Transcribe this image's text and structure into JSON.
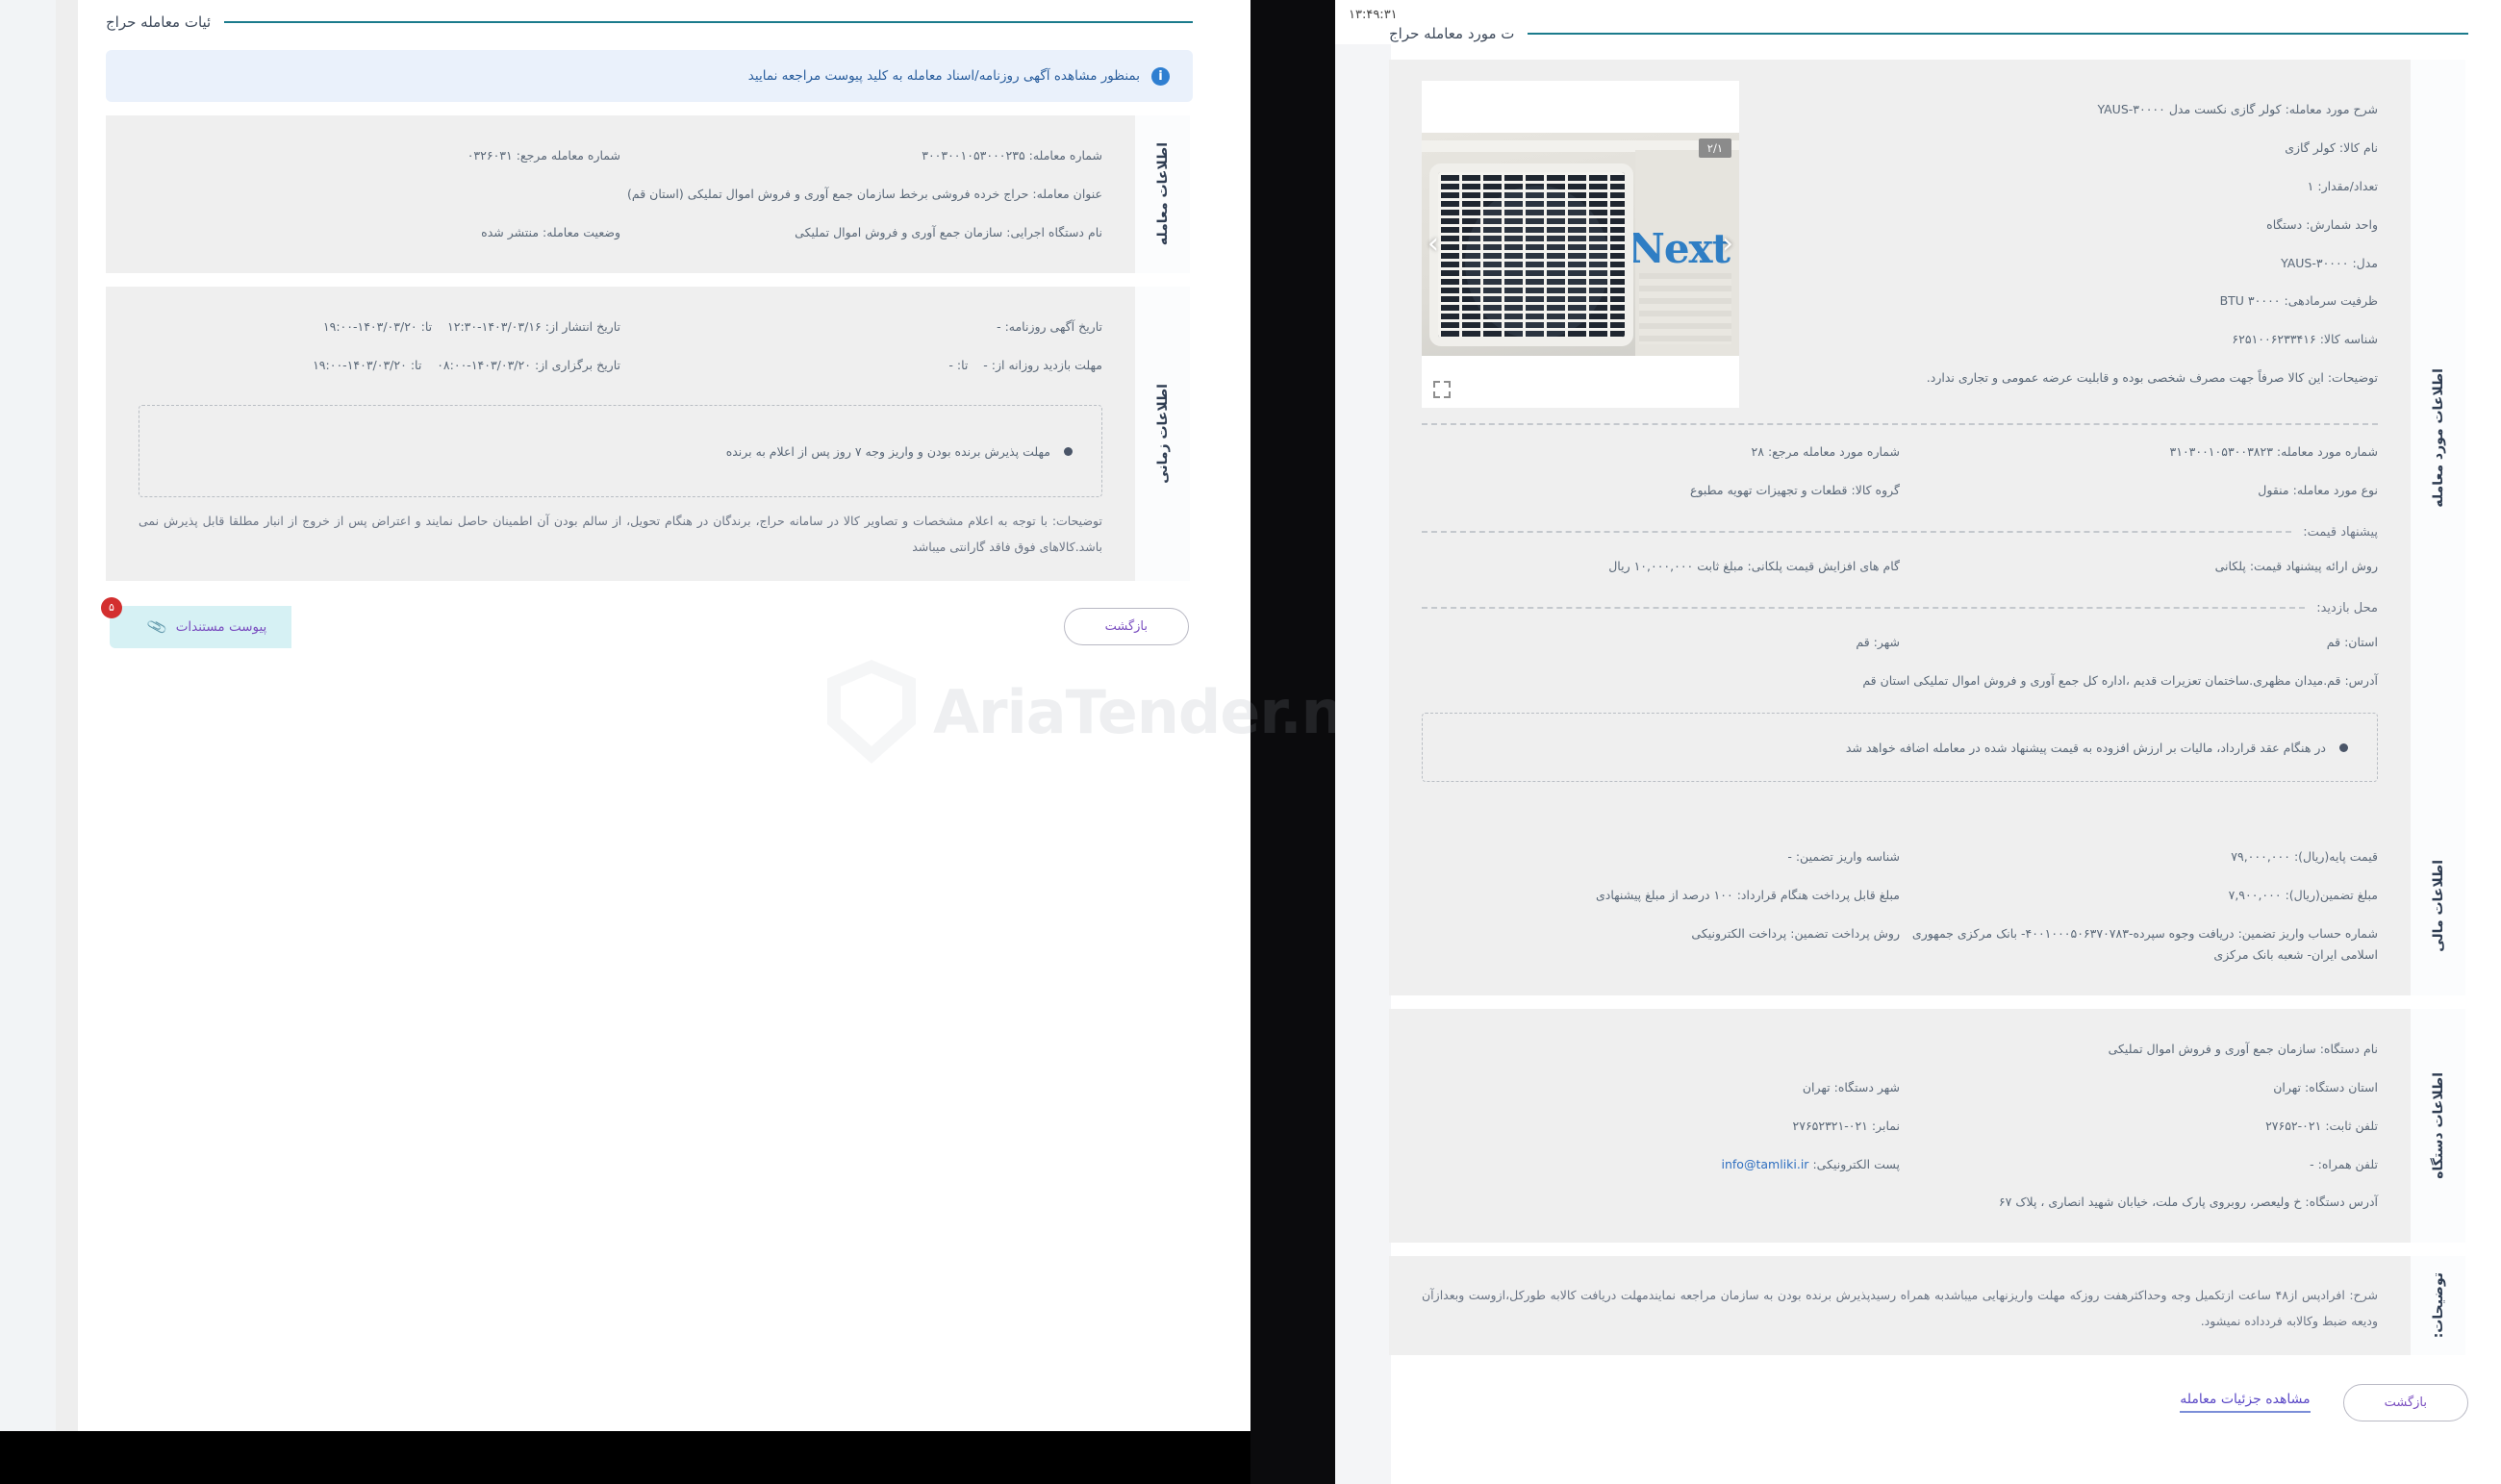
{
  "left_window": {
    "section_title": "ئیات معامله حراج",
    "info_banner": {
      "text": "بمنظور مشاهده آگهی روزنامه/اسناد معامله به کلید پیوست مراجعه نمایید",
      "icon": "info-icon"
    },
    "deal_info": {
      "tab_label": "اطلاعات معامله",
      "transaction_number_label": "شماره معامله:",
      "transaction_number_value": "۳۰۰۳۰۰۱۰۵۳۰۰۰۲۳۵",
      "reference_number_label": "شماره معامله مرجع:",
      "reference_number_value": "۰۳۲۶۰۳۱",
      "title_label": "عنوان معامله:",
      "title_value": "حراج خرده فروشی برخط سازمان جمع آوری و فروش اموال تملیکی (استان قم)",
      "agency_label": "نام دستگاه اجرایی:",
      "agency_value": "سازمان جمع آوری و فروش اموال تملیکی",
      "status_label": "وضعیت معامله:",
      "status_value": "منتشر شده"
    },
    "time_info": {
      "tab_label": "اطلاعات زمانی",
      "newspaper_ad_date_label": "تاریخ آگهی روزنامه:",
      "newspaper_ad_date_value": "-",
      "publish_label": "تاریخ انتشار از:",
      "publish_from": "۱۴۰۳/۰۳/۱۶-۱۲:۳۰",
      "publish_to_label": "تا:",
      "publish_to": "۱۴۰۳/۰۳/۲۰-۱۹:۰۰",
      "visit_label": "مهلت بازدید روزانه از:",
      "visit_from": "-",
      "visit_to_label": "تا:",
      "visit_to": "-",
      "hold_label": "تاریخ برگزاری از:",
      "hold_from": "۱۴۰۳/۰۳/۲۰-۰۸:۰۰",
      "hold_to_label": "تا:",
      "hold_to": "۱۴۰۳/۰۳/۲۰-۱۹:۰۰",
      "deadline_note": "مهلت پذیرش برنده بودن و واریز وجه ۷ روز پس از اعلام به برنده",
      "description": "توضیحات: با توجه به اعلام مشخصات و تصاویر کالا در سامانه حراج، برندگان در هنگام تحویل، از سالم بودن آن اطمینان حاصل نمایند و اعتراض پس از خروج از انبار مطلقا قابل پذیرش نمی باشد.کالاهای فوق فاقد گارانتی میباشد"
    },
    "buttons": {
      "back": "بازگشت",
      "attachments": "پیوست مستندات",
      "attachments_badge": "۵"
    }
  },
  "right_window": {
    "clock": "۱۳:۴۹:۳۱",
    "section_title": "ت مورد معامله حراج",
    "item_info": {
      "tab_label": "اطلاعات مورد معامله",
      "gallery_counter": "۲/۱",
      "specs": [
        {
          "label": "شرح مورد معامله:",
          "value": "کولر گازی نکست مدل YAUS-۳۰۰۰۰"
        },
        {
          "label": "نام کالا:",
          "value": "کولر گازی"
        },
        {
          "label": "تعداد/مقدار:",
          "value": "۱"
        },
        {
          "label": "واحد شمارش:",
          "value": "دستگاه"
        },
        {
          "label": "مدل:",
          "value": "YAUS-۳۰۰۰۰"
        },
        {
          "label": "ظرفیت سرمادهی:",
          "value": "۳۰۰۰۰ BTU"
        },
        {
          "label": "شناسه کالا:",
          "value": "۶۲۵۱۰۰۶۲۳۳۴۱۶"
        },
        {
          "label": "توضیحات:",
          "value": "این کالا صرفاً جهت مصرف شخصی بوده و قابلیت عرضه عمومی و تجاری ندارد."
        }
      ],
      "item_number_label": "شماره مورد معامله:",
      "item_number_value": "۳۱۰۳۰۰۱۰۵۳۰۰۳۸۲۳",
      "item_ref_label": "شماره مورد معامله مرجع:",
      "item_ref_value": "۲۸",
      "item_type_label": "نوع مورد معامله:",
      "item_type_value": "منقول",
      "item_group_label": "گروه کالا:",
      "item_group_value": "قطعات و تجهیزات تهویه مطبوع",
      "price_offer_header": "پیشنهاد قیمت:",
      "offer_method_label": "روش ارائه پیشنهاد قیمت:",
      "offer_method_value": "پلکانی",
      "step_label": "گام های افزایش قیمت پلکانی:",
      "step_value": "مبلغ ثابت ۱۰,۰۰۰,۰۰۰ ریال",
      "visit_place_header": "محل بازدید:",
      "province_label": "استان:",
      "province_value": "قم",
      "city_label": "شهر:",
      "city_value": "قم",
      "address_label": "آدرس:",
      "address_value": "قم.میدان مظهری.ساختمان تعزیرات قدیم ،اداره کل جمع آوری و فروش اموال تملیکی استان قم"
    },
    "financial_info": {
      "tab_label": "اطلاعات مالی",
      "vat_note": "در هنگام عقد قرارداد، مالیات بر ارزش افزوده به قیمت پیشنهاد شده در معامله اضافه خواهد شد",
      "base_price_label": "قیمت پایه(ریال):",
      "base_price_value": "۷۹,۰۰۰,۰۰۰",
      "guarantee_id_label": "شناسه واریز تضمین:",
      "guarantee_id_value": "-",
      "guarantee_amount_label": "مبلغ تضمین(ریال):",
      "guarantee_amount_value": "۷,۹۰۰,۰۰۰",
      "payable_label": "مبلغ قابل پرداخت هنگام قرارداد:",
      "payable_value": "۱۰۰ درصد از مبلغ پیشنهادی",
      "account_label": "شماره حساب واریز تضمین:",
      "account_value": "دریافت وجوه سپرده-۴۰۰۱۰۰۰۵۰۶۳۷۰۷۸۳- بانک مرکزی جمهوری اسلامی ایران- شعبه بانک مرکزی",
      "pay_method_label": "روش پرداخت تضمین:",
      "pay_method_value": "پرداخت الکترونیکی"
    },
    "agency_info": {
      "tab_label": "اطلاعات دستگاه",
      "name_label": "نام دستگاه:",
      "name_value": "سازمان جمع آوری و فروش اموال تملیکی",
      "province_label": "استان دستگاه:",
      "province_value": "تهران",
      "city_label": "شهر دستگاه:",
      "city_value": "تهران",
      "tel_label": "تلفن ثابت:",
      "tel_value": "۰۲۱-۲۷۶۵۲",
      "fax_label": "نمابر:",
      "fax_value": "۰۲۱-۲۷۶۵۲۳۲۱",
      "mobile_label": "تلفن همراه:",
      "mobile_value": "-",
      "email_label": "پست الکترونیکی:",
      "email_value": "info@tamliki.ir",
      "address_label": "آدرس دستگاه:",
      "address_value": "خ ولیعصر، روبروی پارک ملت، خیابان شهید انصاری ، پلاک ۶۷"
    },
    "remarks": {
      "tab_label": "توضیحات:",
      "text": "شرح: افرادپس از۴۸ ساعت ازتکمیل وجه وحداکثرهفت روزکه مهلت واریزنهایی میباشدبه همراه رسیدپذیرش برنده بودن به سازمان مراجعه نمایندمهلت دریافت کالابه طورکل،ازوست وبعدازآن ودیعه ضبط وکالابه فردداده نمیشود."
    },
    "footer": {
      "details_link": "مشاهده جزئیات معامله",
      "back": "بازگشت"
    }
  },
  "watermark": {
    "text": "AriaTender.neT",
    "icon": "shield-icon"
  },
  "colors": {
    "accent_teal": "#1b7b8c",
    "info_blue": "#2f7fd1",
    "purple": "#7b4fc0",
    "card_gray": "#efefef",
    "badge_red": "#d32f2f"
  }
}
